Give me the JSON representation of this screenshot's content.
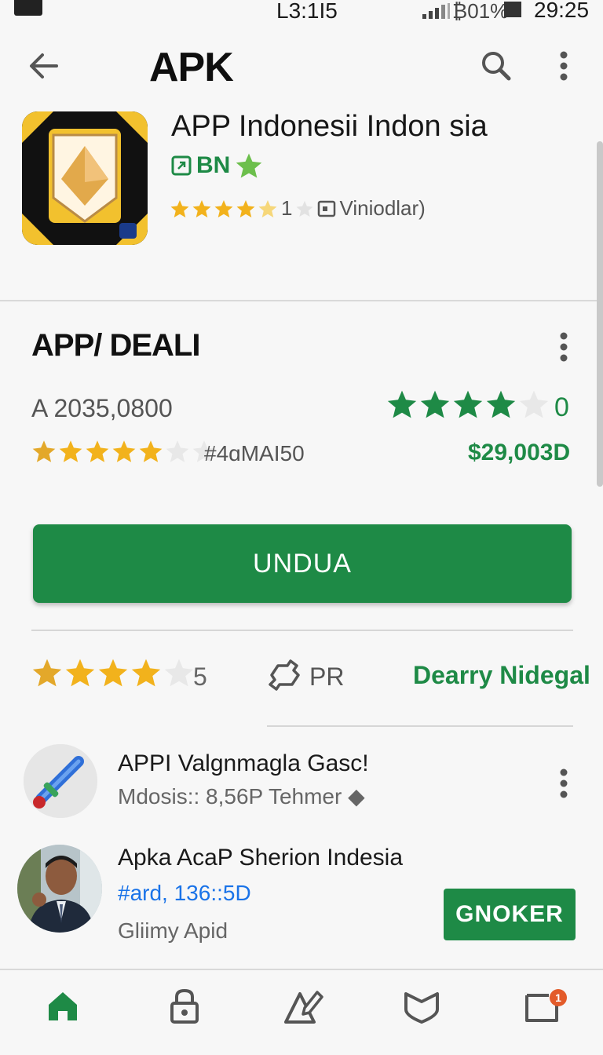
{
  "status_bar": {
    "center_text": "L3:1I5",
    "battery_text": "₿01%",
    "clock": "29:25"
  },
  "app_bar": {
    "title": "APK",
    "back_icon": "arrow-left-icon",
    "search_icon": "search-icon",
    "more_icon": "more-vert-icon"
  },
  "app": {
    "name": "APP Indonesii Indon sia",
    "developer_label": "BN",
    "rating_count": "1",
    "downloads_label": "Viniodlar)"
  },
  "section": {
    "title": "APP/ DEALI",
    "version": "A 2035,0800",
    "big_stars_count": "0",
    "row2_label": "#4ɑMAI50",
    "price": "$29,003D",
    "download_button": "UNDUA"
  },
  "rating_row": {
    "value": "5",
    "pr_label": "PR",
    "link": "Dearry Nidegal"
  },
  "list": [
    {
      "title": "APPI Valgnmagla Gasc!",
      "subtitle": "Mdosis:: 8,56P Tehmer ◆"
    },
    {
      "title": "Apka AcaP Sherion Indesia",
      "subtitle": "#ard, 136::5D",
      "developer": "Gliimy Apid",
      "button": "GNOKER"
    }
  ],
  "bottom_nav": {
    "items": [
      "home-icon",
      "lock-icon",
      "edit-triangle-icon",
      "shield-icon",
      "notification-icon"
    ],
    "badge": "1"
  },
  "colors": {
    "accent": "#1e8a46",
    "star_gold": "#f2b21c",
    "star_green": "#1e8a46",
    "link_blue": "#1a73e8",
    "badge": "#e35b2a"
  }
}
